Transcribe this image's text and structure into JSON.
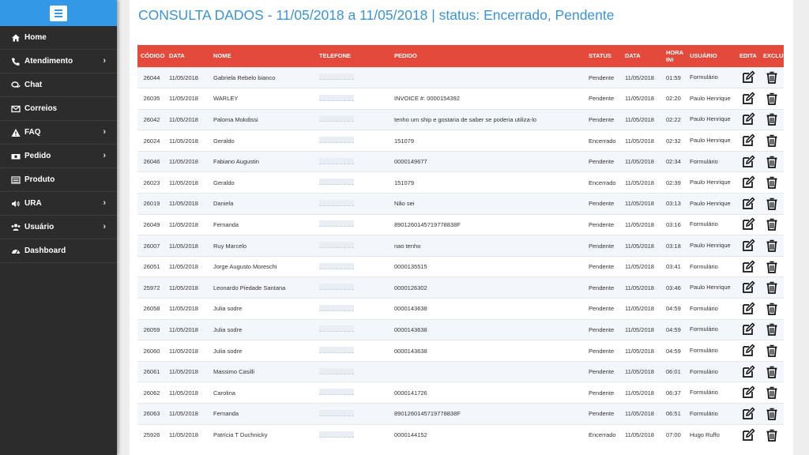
{
  "sidebar": {
    "items": [
      {
        "label": "Home",
        "icon": "home-icon",
        "has_submenu": false
      },
      {
        "label": "Atendimento",
        "icon": "phone-icon",
        "has_submenu": true
      },
      {
        "label": "Chat",
        "icon": "chat-icon",
        "has_submenu": false
      },
      {
        "label": "Correios",
        "icon": "envelope-icon",
        "has_submenu": false
      },
      {
        "label": "FAQ",
        "icon": "warning-icon",
        "has_submenu": true
      },
      {
        "label": "Pedido",
        "icon": "money-icon",
        "has_submenu": true
      },
      {
        "label": "Produto",
        "icon": "list-icon",
        "has_submenu": false
      },
      {
        "label": "URA",
        "icon": "volume-icon",
        "has_submenu": true
      },
      {
        "label": "Usuário",
        "icon": "users-icon",
        "has_submenu": true
      },
      {
        "label": "Dashboard",
        "icon": "dashboard-icon",
        "has_submenu": false
      }
    ],
    "chevron": "›"
  },
  "header": {
    "title": "CONSULTA DADOS - 11/05/2018 a 11/05/2018 | status: Encerrado, Pendente"
  },
  "table": {
    "columns": [
      "CÓDIGO",
      "DATA",
      "NOME",
      "TELEFONE",
      "PEDIDO",
      "STATUS",
      "DATA",
      "HORA INI",
      "USUÁRIO",
      "EDITA",
      "EXCLUI"
    ],
    "rows": [
      {
        "codigo": "26044",
        "data": "11/05/2018",
        "nome": "Gabriela Rebelo bianco",
        "pedido": "",
        "status": "Pendente",
        "data2": "11/05/2018",
        "hora": "01:59",
        "usuario": "Formulário"
      },
      {
        "codigo": "26035",
        "data": "11/05/2018",
        "nome": "WARLEY",
        "pedido": "INVOICE #: 0000154392",
        "status": "Pendente",
        "data2": "11/05/2018",
        "hora": "02:20",
        "usuario": "Paulo Henrique"
      },
      {
        "codigo": "26042",
        "data": "11/05/2018",
        "nome": "Paloma Mokdissi",
        "pedido": "tenho um ship e gostaria de saber se poderia utiliza-lo",
        "status": "Pendente",
        "data2": "11/05/2018",
        "hora": "02:22",
        "usuario": "Paulo Henrique"
      },
      {
        "codigo": "26024",
        "data": "11/05/2018",
        "nome": "Geraldo",
        "pedido": "151079",
        "status": "Encerrado",
        "data2": "11/05/2018",
        "hora": "02:32",
        "usuario": "Paulo Henrique"
      },
      {
        "codigo": "26046",
        "data": "11/05/2018",
        "nome": "Fabiano Augustin",
        "pedido": "0000149677",
        "status": "Pendente",
        "data2": "11/05/2018",
        "hora": "02:34",
        "usuario": "Formulário"
      },
      {
        "codigo": "26023",
        "data": "11/05/2018",
        "nome": "Geraldo",
        "pedido": "151079",
        "status": "Encerrado",
        "data2": "11/05/2018",
        "hora": "02:39",
        "usuario": "Paulo Henrique"
      },
      {
        "codigo": "26019",
        "data": "11/05/2018",
        "nome": "Daniela",
        "pedido": "Não sei",
        "status": "Pendente",
        "data2": "11/05/2018",
        "hora": "03:13",
        "usuario": "Paulo Henrique"
      },
      {
        "codigo": "26049",
        "data": "11/05/2018",
        "nome": "Fernanda",
        "pedido": "8901260145719778838F",
        "status": "Pendente",
        "data2": "11/05/2018",
        "hora": "03:16",
        "usuario": "Formulário"
      },
      {
        "codigo": "26007",
        "data": "11/05/2018",
        "nome": "Ruy Marcelo",
        "pedido": "nao tenho",
        "status": "Pendente",
        "data2": "11/05/2018",
        "hora": "03:18",
        "usuario": "Paulo Henrique"
      },
      {
        "codigo": "26051",
        "data": "11/05/2018",
        "nome": "Jorge Augusto Moreschi",
        "pedido": "0000135515",
        "status": "Pendente",
        "data2": "11/05/2018",
        "hora": "03:41",
        "usuario": "Formulário"
      },
      {
        "codigo": "25972",
        "data": "11/05/2018",
        "nome": "Leonardo Piedade Santana",
        "pedido": "0000126302",
        "status": "Pendente",
        "data2": "11/05/2018",
        "hora": "03:46",
        "usuario": "Paulo Henrique"
      },
      {
        "codigo": "26058",
        "data": "11/05/2018",
        "nome": "Julia sodre",
        "pedido": "0000143638",
        "status": "Pendente",
        "data2": "11/05/2018",
        "hora": "04:59",
        "usuario": "Formulário"
      },
      {
        "codigo": "26059",
        "data": "11/05/2018",
        "nome": "Julia sodre",
        "pedido": "0000143638",
        "status": "Pendente",
        "data2": "11/05/2018",
        "hora": "04:59",
        "usuario": "Formulário"
      },
      {
        "codigo": "26060",
        "data": "11/05/2018",
        "nome": "Julia sodre",
        "pedido": "0000143638",
        "status": "Pendente",
        "data2": "11/05/2018",
        "hora": "04:59",
        "usuario": "Formulário"
      },
      {
        "codigo": "26061",
        "data": "11/05/2018",
        "nome": "Massimo Casilli",
        "pedido": "",
        "status": "Pendente",
        "data2": "11/05/2018",
        "hora": "06:01",
        "usuario": "Formulário"
      },
      {
        "codigo": "26062",
        "data": "11/05/2018",
        "nome": "Carolina",
        "pedido": "0000141726",
        "status": "Pendente",
        "data2": "11/05/2018",
        "hora": "06:37",
        "usuario": "Formulário"
      },
      {
        "codigo": "26063",
        "data": "11/05/2018",
        "nome": "Fernanda",
        "pedido": "8901260145719778838F",
        "status": "Pendente",
        "data2": "11/05/2018",
        "hora": "06:51",
        "usuario": "Formulário"
      },
      {
        "codigo": "25926",
        "data": "11/05/2018",
        "nome": "Patrícia T Duchnicky",
        "pedido": "0000144152",
        "status": "Encerrado",
        "data2": "11/05/2018",
        "hora": "07:00",
        "usuario": "Hugo Ruffo"
      }
    ]
  },
  "colors": {
    "accent": "#3399e6",
    "title": "#3a93d6",
    "header_row": "#e44a3b",
    "sidebar_bg": "#2c2c2c"
  }
}
